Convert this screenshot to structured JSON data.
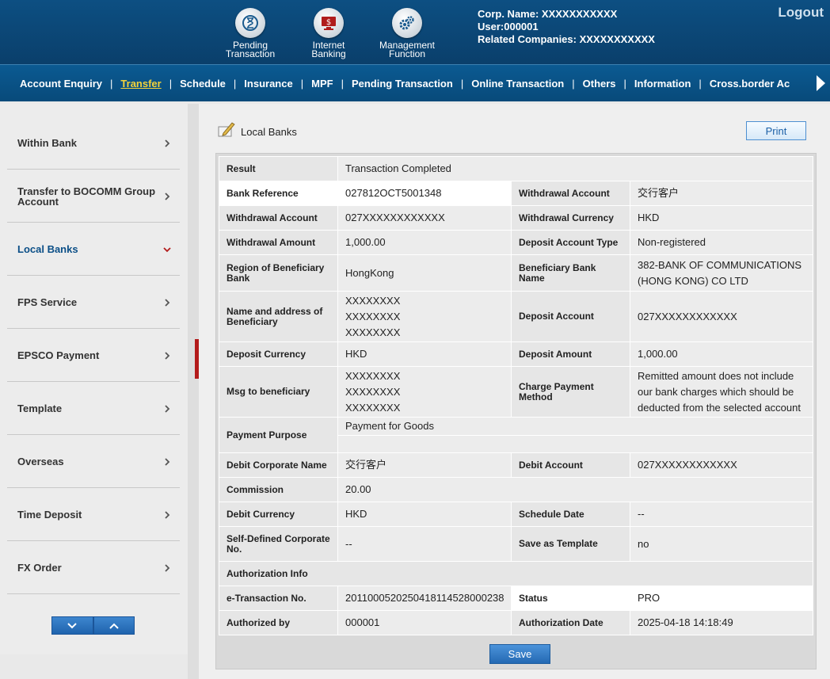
{
  "header": {
    "icons": [
      {
        "name": "pending-transaction",
        "line1": "Pending",
        "line2": "Transaction"
      },
      {
        "name": "internet-banking",
        "line1": "Internet",
        "line2": "Banking"
      },
      {
        "name": "management-function",
        "line1": "Management",
        "line2": "Function"
      }
    ],
    "corp_name": "Corp. Name: XXXXXXXXXXX",
    "user": "User:000001",
    "related": "Related Companies: XXXXXXXXXXX",
    "logout": "Logout"
  },
  "nav": {
    "items": [
      "Account Enquiry",
      "Transfer",
      "Schedule",
      "Insurance",
      "MPF",
      "Pending Transaction",
      "Online Transaction",
      "Others",
      "Information",
      "Cross.border Ac"
    ],
    "active_index": 1,
    "separator": "|"
  },
  "sidebar": {
    "items": [
      "Within Bank",
      "Transfer to BOCOMM Group Account",
      "Local Banks",
      "FPS Service",
      "EPSCO Payment",
      "Template",
      "Overseas",
      "Time Deposit",
      "FX Order"
    ],
    "active_index": 2
  },
  "section": {
    "title": "Local Banks",
    "print": "Print",
    "save": "Save"
  },
  "details": {
    "result_label": "Result",
    "result_value": "Transaction Completed",
    "bank_ref_label": "Bank Reference",
    "bank_ref_value": "027812OCT5001348",
    "wd_account_label_r": "Withdrawal Account",
    "wd_account_value_r": "交行客户",
    "wd_account_label": "Withdrawal Account",
    "wd_account_value": "027XXXXXXXXXXXX",
    "wd_currency_label": "Withdrawal Currency",
    "wd_currency_value": "HKD",
    "wd_amount_label": "Withdrawal Amount",
    "wd_amount_value": "1,000.00",
    "dep_type_label": "Deposit Account Type",
    "dep_type_value": "Non-registered",
    "region_label": "Region of Beneficiary Bank",
    "region_value": "HongKong",
    "ben_bank_label": "Beneficiary Bank Name",
    "ben_bank_value": "382-BANK OF COMMUNICATIONS (HONG KONG) CO LTD",
    "name_addr_label": "Name and address of Beneficiary",
    "name_addr_l1": "XXXXXXXX",
    "name_addr_l2": "XXXXXXXX",
    "name_addr_l3": "XXXXXXXX",
    "dep_account_label": "Deposit Account",
    "dep_account_value": "027XXXXXXXXXXXX",
    "dep_currency_label": "Deposit Currency",
    "dep_currency_value": "HKD",
    "dep_amount_label": "Deposit Amount",
    "dep_amount_value": "1,000.00",
    "msg_label": "Msg to beneficiary",
    "msg_l1": "XXXXXXXX",
    "msg_l2": "XXXXXXXX",
    "msg_l3": "XXXXXXXX",
    "charge_label": "Charge Payment Method",
    "charge_value": "Remitted amount does not include our bank charges which should be deducted from the selected account",
    "purpose_label": "Payment Purpose",
    "purpose_value": "Payment for Goods",
    "debit_name_label": "Debit Corporate Name",
    "debit_name_value": "交行客户",
    "debit_account_label": "Debit Account",
    "debit_account_value": "027XXXXXXXXXXXX",
    "commission_label": "Commission",
    "commission_value": "20.00",
    "debit_currency_label": "Debit Currency",
    "debit_currency_value": "HKD",
    "schedule_label": "Schedule Date",
    "schedule_value": "--",
    "self_no_label": "Self-Defined Corporate No.",
    "self_no_value": "--",
    "save_template_label": "Save as Template",
    "save_template_value": "no",
    "auth_info_label": "Authorization Info",
    "etx_label": "e-Transaction No.",
    "etx_value": "2011000520250418114528000238",
    "status_label": "Status",
    "status_value": "PRO",
    "auth_by_label": "Authorized by",
    "auth_by_value": "000001",
    "auth_date_label": "Authorization Date",
    "auth_date_value": "2025-04-18 14:18:49"
  }
}
